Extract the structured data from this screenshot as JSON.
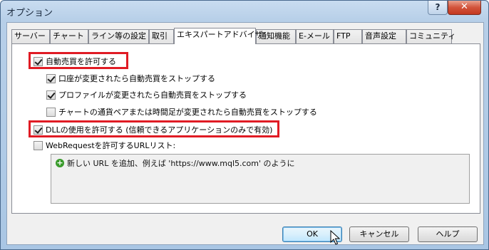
{
  "window": {
    "title": "オプション",
    "help_label": "?",
    "close_label": "✕"
  },
  "tabs": [
    "サーバー",
    "チャート",
    "ライン等の設定",
    "取引",
    "エキスパートアドバイザ",
    "通知機能",
    "E-メール",
    "FTP",
    "音声設定",
    "コミュニティ"
  ],
  "active_tab": "エキスパートアドバイザ",
  "options": {
    "allow_auto_trading": {
      "label": "自動売買を許可する",
      "checked": true
    },
    "stop_on_account_change": {
      "label": "口座が変更されたら自動売買をストップする",
      "checked": true
    },
    "stop_on_profile_change": {
      "label": "プロファイルが変更されたら自動売買をストップする",
      "checked": true
    },
    "stop_on_chart_change": {
      "label": "チャートの通貨ペアまたは時間足が変更されたら自動売買をストップする",
      "checked": false
    },
    "allow_dll": {
      "label": "DLLの使用を許可する (信頼できるアプリケーションのみで有効)",
      "checked": true
    },
    "allow_webrequest": {
      "label": "WebRequestを許可するURLリスト:",
      "checked": false
    }
  },
  "url_list": {
    "add_label": "新しい URL を追加、例えば 'https://www.mql5.com' のように",
    "add_icon": "plus-circle-icon"
  },
  "buttons": {
    "ok": "OK",
    "cancel": "キャンセル",
    "help": "ヘルプ"
  },
  "colors": {
    "highlight": "#e01b24",
    "add_icon": "#3a9b2c"
  }
}
